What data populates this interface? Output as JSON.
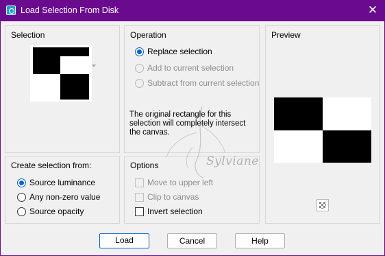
{
  "window": {
    "title": "Load Selection From Disk",
    "close_glyph": "✕"
  },
  "selection": {
    "title": "Selection"
  },
  "operation": {
    "title": "Operation",
    "options": [
      {
        "label": "Replace selection",
        "selected": true,
        "enabled": true
      },
      {
        "label": "Add to current selection",
        "selected": false,
        "enabled": false
      },
      {
        "label": "Subtract from current selection",
        "selected": false,
        "enabled": false
      }
    ],
    "message": "The original rectangle for this selection will completely intersect the canvas."
  },
  "preview": {
    "title": "Preview",
    "toggle_icon": "checkerboard-icon"
  },
  "create_from": {
    "title": "Create selection from:",
    "options": [
      {
        "label": "Source luminance",
        "selected": true
      },
      {
        "label": "Any non-zero value",
        "selected": false
      },
      {
        "label": "Source opacity",
        "selected": false
      }
    ]
  },
  "options": {
    "title": "Options",
    "items": [
      {
        "label": "Move to upper left",
        "checked": false,
        "enabled": false
      },
      {
        "label": "Clip to canvas",
        "checked": false,
        "enabled": false
      },
      {
        "label": "Invert selection",
        "checked": false,
        "enabled": true
      }
    ]
  },
  "watermark": {
    "text": "Sylviane"
  },
  "buttons": {
    "load": "Load",
    "cancel": "Cancel",
    "help": "Help"
  },
  "colors": {
    "titlebar": "#6a0a8e",
    "accent": "#0a63c9",
    "dialog": "#f0f0f0"
  }
}
